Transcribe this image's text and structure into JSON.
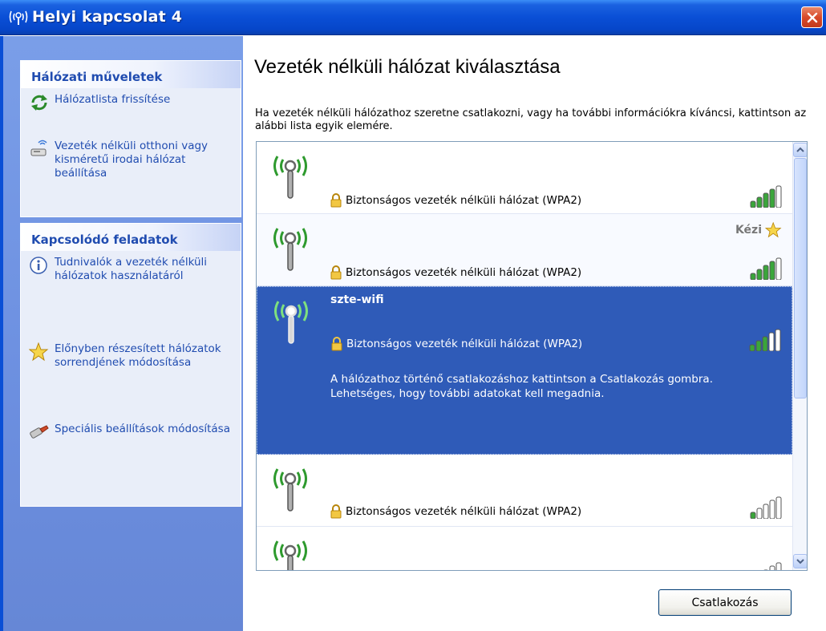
{
  "window": {
    "title": "Helyi kapcsolat 4",
    "close_icon": "close-icon"
  },
  "sidebar": {
    "network_tasks": {
      "heading": "Hálózati műveletek",
      "items": [
        {
          "label": "Hálózatlista frissítése",
          "icon": "refresh-icon"
        },
        {
          "label": "Vezeték nélküli otthoni vagy kisméretű irodai hálózat beállítása",
          "icon": "network-setup-icon"
        }
      ]
    },
    "related_tasks": {
      "heading": "Kapcsolódó feladatok",
      "items": [
        {
          "label": "Tudnivalók a vezeték nélküli hálózatok használatáról",
          "icon": "info-icon"
        },
        {
          "label": "Előnyben részesített hálózatok sorrendjének módosítása",
          "icon": "star-icon"
        },
        {
          "label": "Speciális beállítások módosítása",
          "icon": "settings-icon"
        }
      ]
    }
  },
  "main": {
    "heading": "Vezeték nélküli hálózat kiválasztása",
    "intro": "Ha vezeték nélküli hálózathoz szeretne csatlakozni, vagy ha további információkra kíváncsi, kattintson az alábbi lista egyik elemére.",
    "networks": [
      {
        "ssid": "",
        "security": "Biztonságos vezeték nélküli hálózat (WPA2)",
        "signal": 0.8,
        "manual": ""
      },
      {
        "ssid": "",
        "security": "Biztonságos vezeték nélküli hálózat (WPA2)",
        "signal": 0.8,
        "manual": "Kézi"
      },
      {
        "ssid": "szte-wifi",
        "security": "Biztonságos vezeték nélküli hálózat (WPA2)",
        "signal": 0.6,
        "manual": "",
        "selected": true,
        "description": "A hálózathoz történő csatlakozáshoz kattintson a Csatlakozás gombra. Lehetséges, hogy további adatokat kell megadnia."
      },
      {
        "ssid": "",
        "security": "Biztonságos vezeték nélküli hálózat (WPA2)",
        "signal": 0.2,
        "manual": ""
      },
      {
        "ssid": "",
        "security": "",
        "signal": 0.2,
        "manual": ""
      }
    ],
    "connect_button": {
      "label": "Csatlakozás"
    }
  },
  "colors": {
    "title_bar": "#0a4fd6",
    "sidebar": "#7a9ee8",
    "link": "#204cb0",
    "selection": "#2f5bb8",
    "signal_green": "#3aa63a"
  }
}
